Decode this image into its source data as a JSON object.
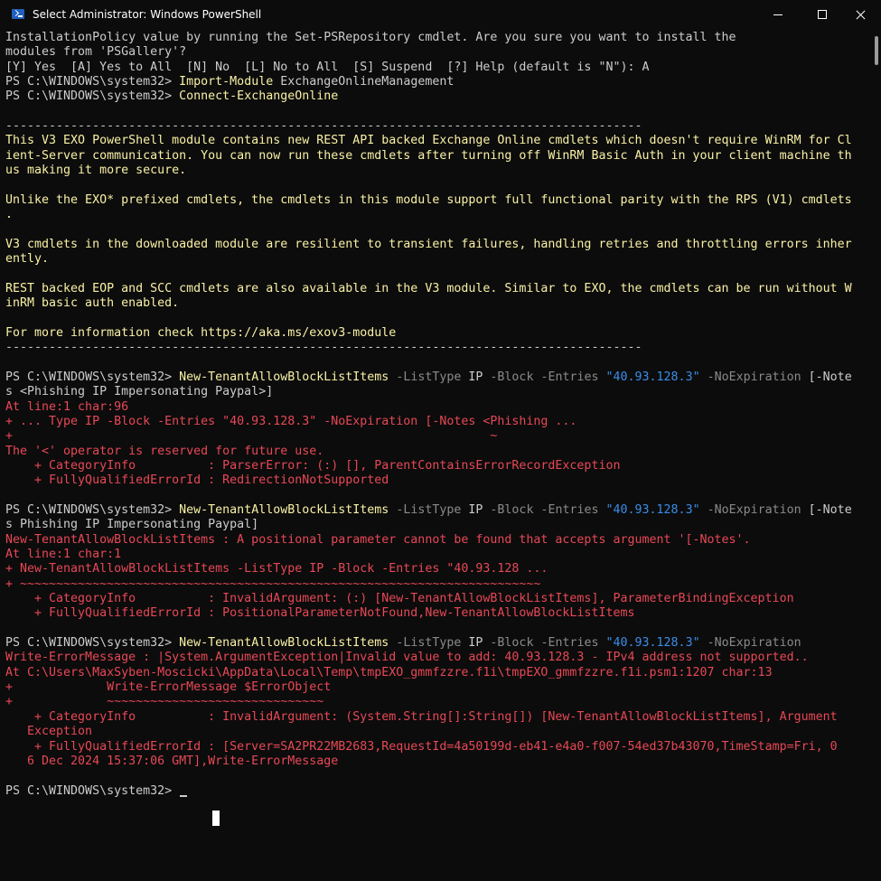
{
  "window": {
    "title": "Select Administrator: Windows PowerShell",
    "minimize_icon": "minimize-icon",
    "maximize_icon": "maximize-icon",
    "close_icon": "close-icon",
    "app_icon": "powershell-icon"
  },
  "colors": {
    "background": "#0c0c0c",
    "text": "#cccccc",
    "command": "#f9f1a5",
    "parameter": "#8a8a8a",
    "string": "#3b8eea",
    "error": "#e74856"
  },
  "console": {
    "lines": [
      [
        {
          "t": "InstallationPolicy value by running the Set-PSRepository cmdlet. Are you sure you want to install the",
          "c": "w"
        }
      ],
      [
        {
          "t": "modules from 'PSGallery'?",
          "c": "w"
        }
      ],
      [
        {
          "t": "[Y] Yes  [A] Yes to All  [N] No  [L] No to All  [S] Suspend  [?] Help (default is \"N\"): A",
          "c": "w"
        }
      ],
      [
        {
          "t": "PS C:\\WINDOWS\\system32> ",
          "c": "w"
        },
        {
          "t": "Import-Module",
          "c": "y"
        },
        {
          "t": " ExchangeOnlineManagement",
          "c": "w"
        }
      ],
      [
        {
          "t": "PS C:\\WINDOWS\\system32> ",
          "c": "w"
        },
        {
          "t": "Connect-ExchangeOnline",
          "c": "y"
        }
      ],
      [],
      [
        {
          "t": "----------------------------------------------------------------------------------------",
          "c": "w"
        }
      ],
      [
        {
          "t": "This V3 EXO PowerShell module contains new REST API backed Exchange Online cmdlets which doesn't require WinRM for Cl",
          "c": "y"
        }
      ],
      [
        {
          "t": "ient-Server communication. You can now run these cmdlets after turning off WinRM Basic Auth in your client machine th",
          "c": "y"
        }
      ],
      [
        {
          "t": "us making it more secure.",
          "c": "y"
        }
      ],
      [],
      [
        {
          "t": "Unlike the EXO* prefixed cmdlets, the cmdlets in this module support full functional parity with the RPS (V1) cmdlets",
          "c": "y"
        }
      ],
      [
        {
          "t": ".",
          "c": "y"
        }
      ],
      [],
      [
        {
          "t": "V3 cmdlets in the downloaded module are resilient to transient failures, handling retries and throttling errors inher",
          "c": "y"
        }
      ],
      [
        {
          "t": "ently.",
          "c": "y"
        }
      ],
      [],
      [
        {
          "t": "REST backed EOP and SCC cmdlets are also available in the V3 module. Similar to EXO, the cmdlets can be run without W",
          "c": "y"
        }
      ],
      [
        {
          "t": "inRM basic auth enabled.",
          "c": "y"
        }
      ],
      [],
      [
        {
          "t": "For more information check https://aka.ms/exov3-module",
          "c": "y"
        }
      ],
      [
        {
          "t": "----------------------------------------------------------------------------------------",
          "c": "w"
        }
      ],
      [],
      [
        {
          "t": "PS C:\\WINDOWS\\system32> ",
          "c": "w"
        },
        {
          "t": "New-TenantAllowBlockListItems",
          "c": "y"
        },
        {
          "t": " -ListType",
          "c": "g"
        },
        {
          "t": " IP",
          "c": "w"
        },
        {
          "t": " -Block -Entries",
          "c": "g"
        },
        {
          "t": " \"40.93.128.3\"",
          "c": "b"
        },
        {
          "t": " -NoExpiration",
          "c": "g"
        },
        {
          "t": " [-Note",
          "c": "w"
        }
      ],
      [
        {
          "t": "s <Phishing IP Impersonating Paypal>]",
          "c": "w"
        }
      ],
      [
        {
          "t": "At line:1 char:96",
          "c": "r"
        }
      ],
      [
        {
          "t": "+ ... Type IP -Block -Entries \"40.93.128.3\" -NoExpiration [-Notes <Phishing ...",
          "c": "r"
        }
      ],
      [
        {
          "t": "+                                                                  ~",
          "c": "r"
        }
      ],
      [
        {
          "t": "The '<' operator is reserved for future use.",
          "c": "r"
        }
      ],
      [
        {
          "t": "    + CategoryInfo          : ParserError: (:) [], ParentContainsErrorRecordException",
          "c": "r"
        }
      ],
      [
        {
          "t": "    + FullyQualifiedErrorId : RedirectionNotSupported",
          "c": "r"
        }
      ],
      [],
      [
        {
          "t": "PS C:\\WINDOWS\\system32> ",
          "c": "w"
        },
        {
          "t": "New-TenantAllowBlockListItems",
          "c": "y"
        },
        {
          "t": " -ListType",
          "c": "g"
        },
        {
          "t": " IP",
          "c": "w"
        },
        {
          "t": " -Block -Entries",
          "c": "g"
        },
        {
          "t": " \"40.93.128.3\"",
          "c": "b"
        },
        {
          "t": " -NoExpiration",
          "c": "g"
        },
        {
          "t": " [-Note",
          "c": "w"
        }
      ],
      [
        {
          "t": "s Phishing IP Impersonating Paypal]",
          "c": "w"
        }
      ],
      [
        {
          "t": "New-TenantAllowBlockListItems : A positional parameter cannot be found that accepts argument '[-Notes'.",
          "c": "r"
        }
      ],
      [
        {
          "t": "At line:1 char:1",
          "c": "r"
        }
      ],
      [
        {
          "t": "+ New-TenantAllowBlockListItems -ListType IP -Block -Entries \"40.93.128 ...",
          "c": "r"
        }
      ],
      [
        {
          "t": "+ ~~~~~~~~~~~~~~~~~~~~~~~~~~~~~~~~~~~~~~~~~~~~~~~~~~~~~~~~~~~~~~~~~~~~~~~~",
          "c": "r"
        }
      ],
      [
        {
          "t": "    + CategoryInfo          : InvalidArgument: (:) [New-TenantAllowBlockListItems], ParameterBindingException",
          "c": "r"
        }
      ],
      [
        {
          "t": "    + FullyQualifiedErrorId : PositionalParameterNotFound,New-TenantAllowBlockListItems",
          "c": "r"
        }
      ],
      [],
      [
        {
          "t": "PS C:\\WINDOWS\\system32> ",
          "c": "w"
        },
        {
          "t": "New-TenantAllowBlockListItems",
          "c": "y"
        },
        {
          "t": " -ListType",
          "c": "g"
        },
        {
          "t": " IP",
          "c": "w"
        },
        {
          "t": " -Block -Entries",
          "c": "g"
        },
        {
          "t": " \"40.93.128.3\"",
          "c": "b"
        },
        {
          "t": " -NoExpiration",
          "c": "g"
        }
      ],
      [
        {
          "t": "Write-ErrorMessage : |System.ArgumentException|Invalid value to add: 40.93.128.3 - IPv4 address not supported..",
          "c": "r"
        }
      ],
      [
        {
          "t": "At C:\\Users\\MaxSyben-Moscicki\\AppData\\Local\\Temp\\tmpEXO_gmmfzzre.f1i\\tmpEXO_gmmfzzre.f1i.psm1:1207 char:13",
          "c": "r"
        }
      ],
      [
        {
          "t": "+             Write-ErrorMessage $ErrorObject",
          "c": "r"
        }
      ],
      [
        {
          "t": "+             ~~~~~~~~~~~~~~~~~~~~~~~~~~~~~~",
          "c": "r"
        }
      ],
      [
        {
          "t": "    + CategoryInfo          : InvalidArgument: (System.String[]:String[]) [New-TenantAllowBlockListItems], Argument",
          "c": "r"
        }
      ],
      [
        {
          "t": "   Exception",
          "c": "r"
        }
      ],
      [
        {
          "t": "    + FullyQualifiedErrorId : [Server=SA2PR22MB2683,RequestId=4a50199d-eb41-e4a0-f007-54ed37b43070,TimeStamp=Fri, 0",
          "c": "r"
        }
      ],
      [
        {
          "t": "   6 Dec 2024 15:37:06 GMT],Write-ErrorMessage",
          "c": "r"
        }
      ],
      [],
      [
        {
          "t": "PS C:\\WINDOWS\\system32> ",
          "c": "w"
        }
      ]
    ]
  }
}
